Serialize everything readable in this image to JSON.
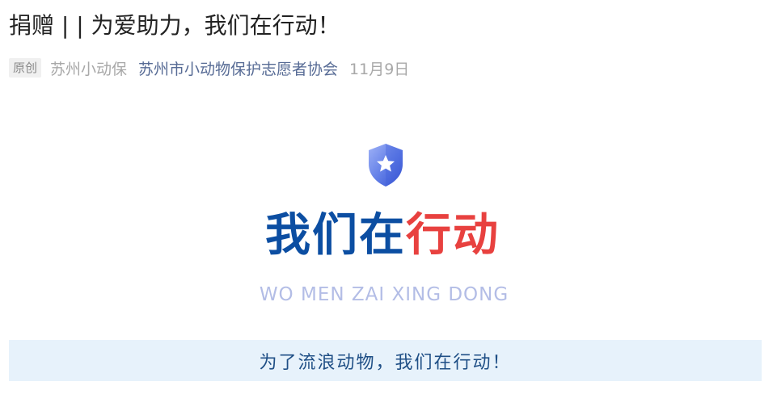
{
  "article": {
    "title": "捐赠 | | 为爱助力，我们在行动！",
    "original_badge": "原创",
    "author": "苏州小动保",
    "account_name": "苏州市小动物保护志愿者协会",
    "date": "11月9日"
  },
  "hero": {
    "icon": "shield-star-icon",
    "headline_blue": "我们在",
    "headline_red": "行动",
    "pinyin": "WO MEN ZAI XING DONG",
    "banner_text": "为了流浪动物，我们在行动！"
  },
  "colors": {
    "title_text": "#222222",
    "account_link": "#576b95",
    "meta_gray": "#a8a8a8",
    "headline_blue": "#0c4ea2",
    "headline_red": "#e8413f",
    "pinyin": "#b3bde6",
    "banner_bg": "#e7f2fb",
    "banner_text": "#1f4f86",
    "shield_light": "#8aa0f2",
    "shield_dark": "#3f5fd9"
  }
}
